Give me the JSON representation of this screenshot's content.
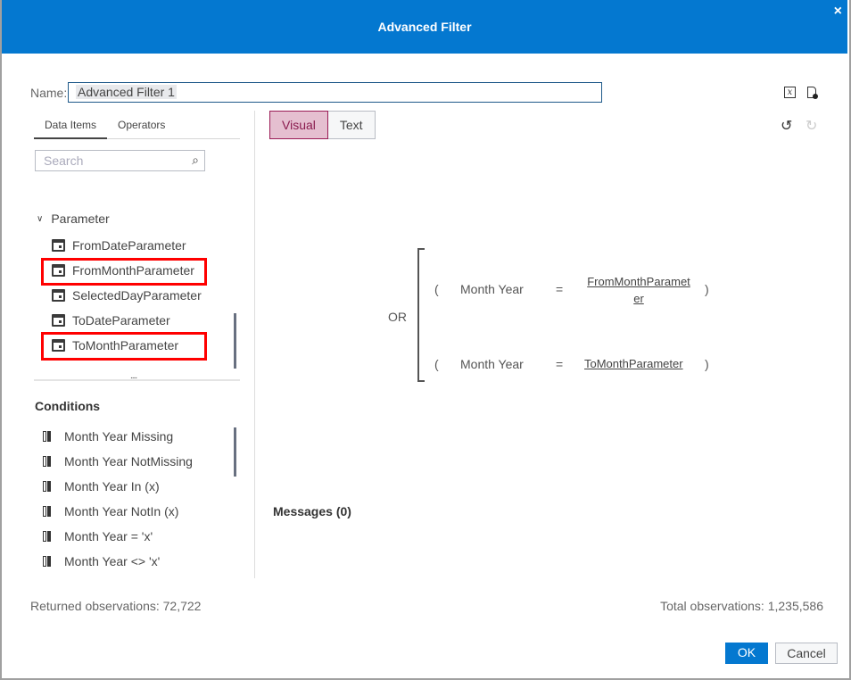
{
  "dialog": {
    "title": "Advanced Filter",
    "close_icon": "×"
  },
  "name": {
    "label": "Name:",
    "value": "Advanced Filter 1"
  },
  "left_tabs": [
    {
      "label": "Data Items",
      "active": true
    },
    {
      "label": "Operators",
      "active": false
    }
  ],
  "search": {
    "placeholder": "Search"
  },
  "tree": {
    "group": "Parameter",
    "items": [
      "FromDateParameter",
      "FromMonthParameter",
      "SelectedDayParameter",
      "ToDateParameter",
      "ToMonthParameter"
    ],
    "highlighted": [
      "FromMonthParameter",
      "ToMonthParameter"
    ]
  },
  "splitter": "....",
  "conditions": {
    "title": "Conditions",
    "items": [
      "Month Year Missing",
      "Month Year NotMissing",
      "Month Year In (x)",
      "Month Year NotIn (x)",
      "Month Year = 'x'",
      "Month Year <> 'x'"
    ]
  },
  "mode_tabs": {
    "visual": "Visual",
    "text": "Text",
    "active": "Visual"
  },
  "expression": {
    "operator": "OR",
    "rows": [
      {
        "open": "(",
        "column": "Month Year",
        "op": "=",
        "value_line1": "FromMonthParamet",
        "value_line2": "er",
        "close": ")"
      },
      {
        "open": "(",
        "column": "Month Year",
        "op": "=",
        "value": "ToMonthParameter",
        "close": ")"
      }
    ]
  },
  "messages": "Messages (0)",
  "footer": {
    "returned": "Returned observations:  72,722",
    "total": "Total observations:  1,235,586",
    "ok": "OK",
    "cancel": "Cancel"
  },
  "colors": {
    "header": "#0478d0",
    "highlight": "#ff0000",
    "visual_bg": "#e5bfd0"
  }
}
